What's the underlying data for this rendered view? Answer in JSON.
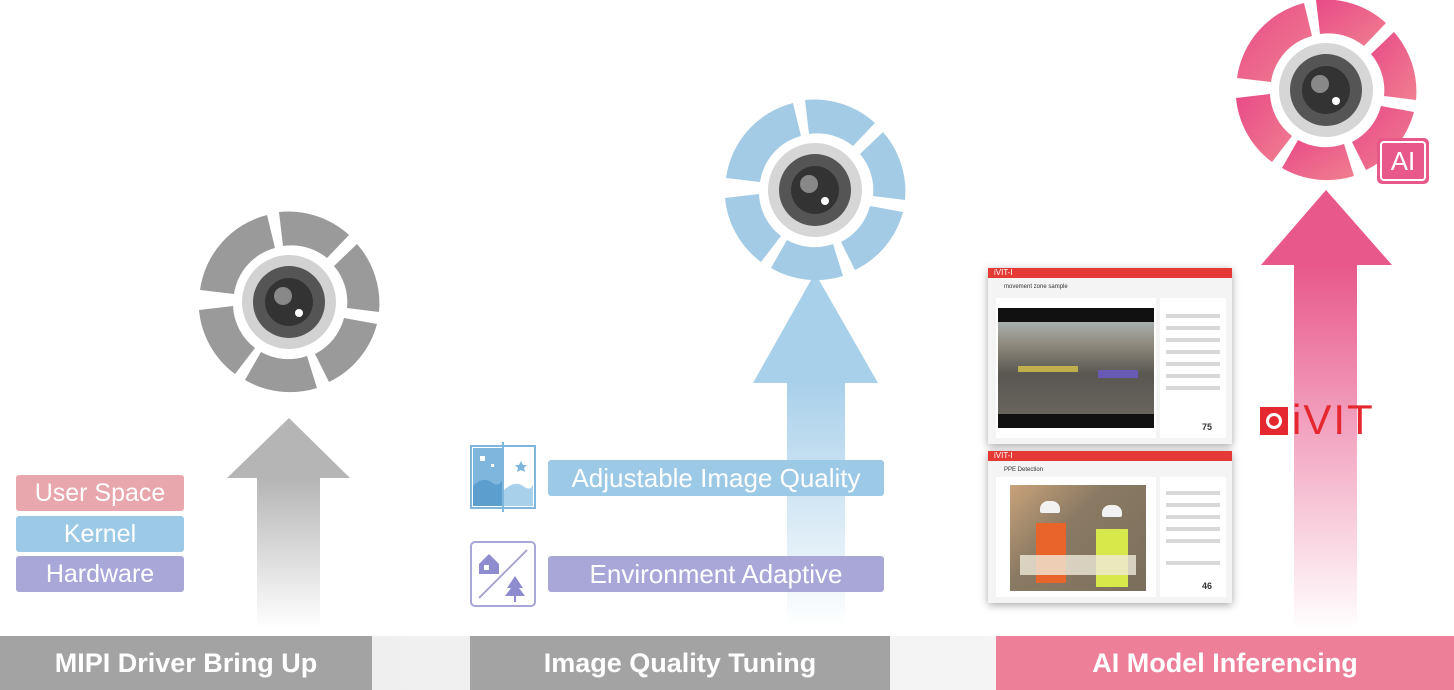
{
  "colors": {
    "gray": "#a8a8a8",
    "blue": "#a9d0ea",
    "pink": "#ea5a8e",
    "label_gray": "#a3a3a3",
    "label_pink": "#ee7f99",
    "user_space": "#e8a7ac",
    "kernel": "#9cc9e6",
    "hardware": "#a9a6d8",
    "ivit_red": "#e5282f"
  },
  "stages": [
    {
      "label": "MIPI Driver Bring Up",
      "icon": "camera-shutter-icon"
    },
    {
      "label": "Image Quality Tuning",
      "icon": "camera-shutter-icon"
    },
    {
      "label": "AI Model Inferencing",
      "icon": "camera-shutter-ai-icon",
      "badge": "AI"
    }
  ],
  "layers": [
    "User Space",
    "Kernel",
    "Hardware"
  ],
  "features": [
    {
      "label": "Adjustable Image Quality",
      "icon": "day-night-image-icon"
    },
    {
      "label": "Environment Adaptive",
      "icon": "indoor-outdoor-icon"
    }
  ],
  "ivit": {
    "logo_text": "iVIT",
    "app_brand": "iVIT-I",
    "screenshots": [
      {
        "title": "movement zone sample"
      },
      {
        "title": "PPE Detection"
      }
    ],
    "stats": [
      "75",
      "46"
    ]
  }
}
